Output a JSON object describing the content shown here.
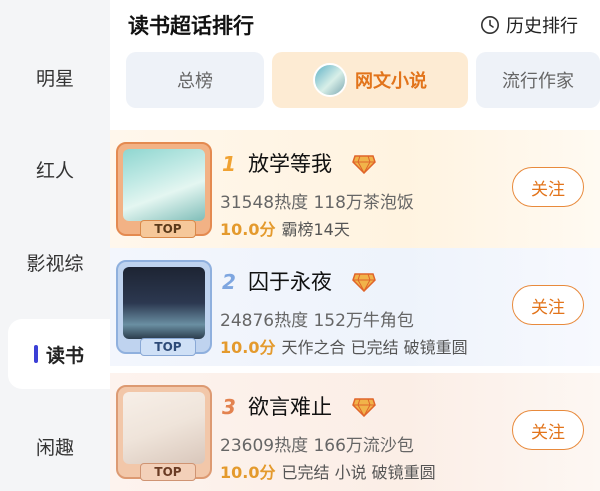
{
  "header": {
    "title": "读书超话排行",
    "history_label": "历史排行"
  },
  "sidebar": {
    "items": [
      {
        "label": "明星"
      },
      {
        "label": "红人"
      },
      {
        "label": "影视综"
      },
      {
        "label": "读书"
      },
      {
        "label": "闲趣"
      }
    ],
    "active": "读书"
  },
  "tabs": [
    {
      "label": "总榜"
    },
    {
      "label": "网文小说"
    },
    {
      "label": "流行作家"
    }
  ],
  "active_tab": "网文小说",
  "rankings": [
    {
      "rank": "1",
      "title": "放学等我",
      "stats": "31548热度 118万茶泡饭",
      "score": "10.0分",
      "tags": "霸榜14天",
      "badge": "TOP",
      "follow_label": "关注"
    },
    {
      "rank": "2",
      "title": "囚于永夜",
      "stats": "24876热度 152万牛角包",
      "score": "10.0分",
      "tags": "天作之合 已完结 破镜重圆",
      "badge": "TOP",
      "follow_label": "关注"
    },
    {
      "rank": "3",
      "title": "欲言难止",
      "stats": "23609热度 166万流沙包",
      "score": "10.0分",
      "tags": "已完结 小说 破镜重圆",
      "badge": "TOP",
      "follow_label": "关注"
    }
  ],
  "colors": {
    "accent": "#e2741b",
    "score": "#e49a2d",
    "sidebar_indicator": "#3b3fd6"
  },
  "icons": {
    "history": "clock-icon",
    "gem": "gem-icon"
  }
}
